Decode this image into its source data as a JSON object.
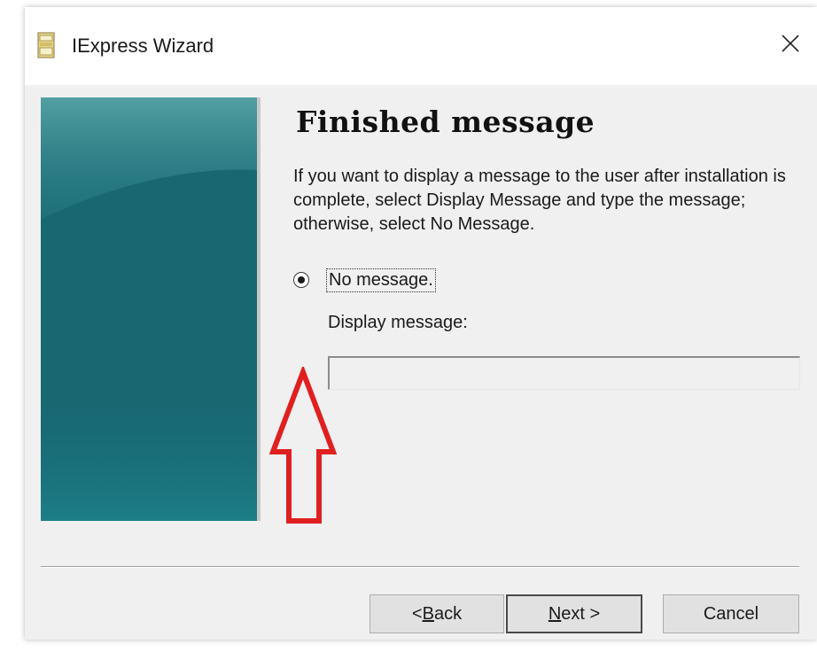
{
  "window": {
    "title": "IExpress Wizard"
  },
  "page": {
    "heading": "Finished message",
    "description": "If you want to display a message to the user after installation is complete, select Display Message and type the message; otherwise, select No Message."
  },
  "options": {
    "no_message_label": "No message.",
    "no_message_selected": true,
    "display_message_label": "Display message:",
    "display_message_value": ""
  },
  "buttons": {
    "back_prefix": "< ",
    "back_mnemonic": "B",
    "back_rest": "ack",
    "next_mnemonic": "N",
    "next_rest": "ext >",
    "cancel": "Cancel"
  },
  "annotation": {
    "arrow_color": "#e02020"
  },
  "icons": {
    "app": "iexpress-app-icon",
    "close": "close-icon"
  }
}
